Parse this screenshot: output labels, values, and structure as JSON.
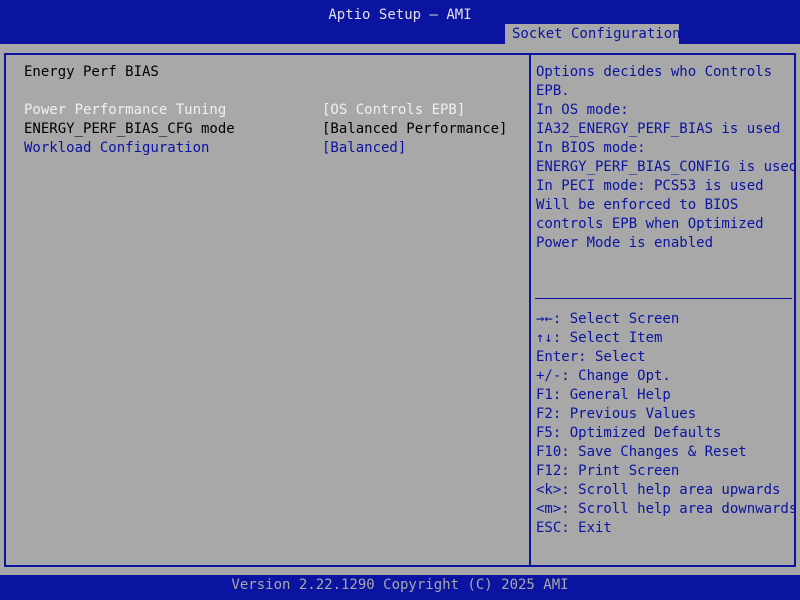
{
  "header": {
    "title": "Aptio Setup – AMI",
    "active_tab": "Socket Configuration"
  },
  "main": {
    "section_title": "Energy Perf BIAS",
    "settings": [
      {
        "label": "Power Performance Tuning",
        "value": "[OS Controls EPB]"
      },
      {
        "label": "ENERGY_PERF_BIAS_CFG mode",
        "value": "[Balanced Performance]"
      },
      {
        "label": "Workload Configuration",
        "value": "[Balanced]"
      }
    ]
  },
  "help": {
    "lines": [
      "Options decides who Controls",
      "EPB.",
      "In OS mode:",
      "IA32_ENERGY_PERF_BIAS is used",
      "In BIOS mode:",
      "ENERGY_PERF_BIAS_CONFIG is used",
      "In PECI mode: PCS53 is used",
      "Will be enforced to BIOS",
      "controls EPB when Optimized",
      "Power Mode is enabled"
    ]
  },
  "keys": {
    "items": [
      "→←: Select Screen",
      "↑↓: Select Item",
      "Enter: Select",
      "+/-: Change Opt.",
      "F1: General Help",
      "F2: Previous Values",
      "F5: Optimized Defaults",
      "F10: Save Changes & Reset",
      "F12: Print Screen",
      "<k>: Scroll help area upwards",
      "<m>: Scroll help area downwards",
      "ESC: Exit"
    ]
  },
  "footer": {
    "text": "Version 2.22.1290 Copyright (C) 2025 AMI"
  },
  "colors": {
    "bios_blue": "#0a14a0",
    "panel_gray": "#a8a8a8",
    "highlight_white": "#f0f0f0"
  }
}
